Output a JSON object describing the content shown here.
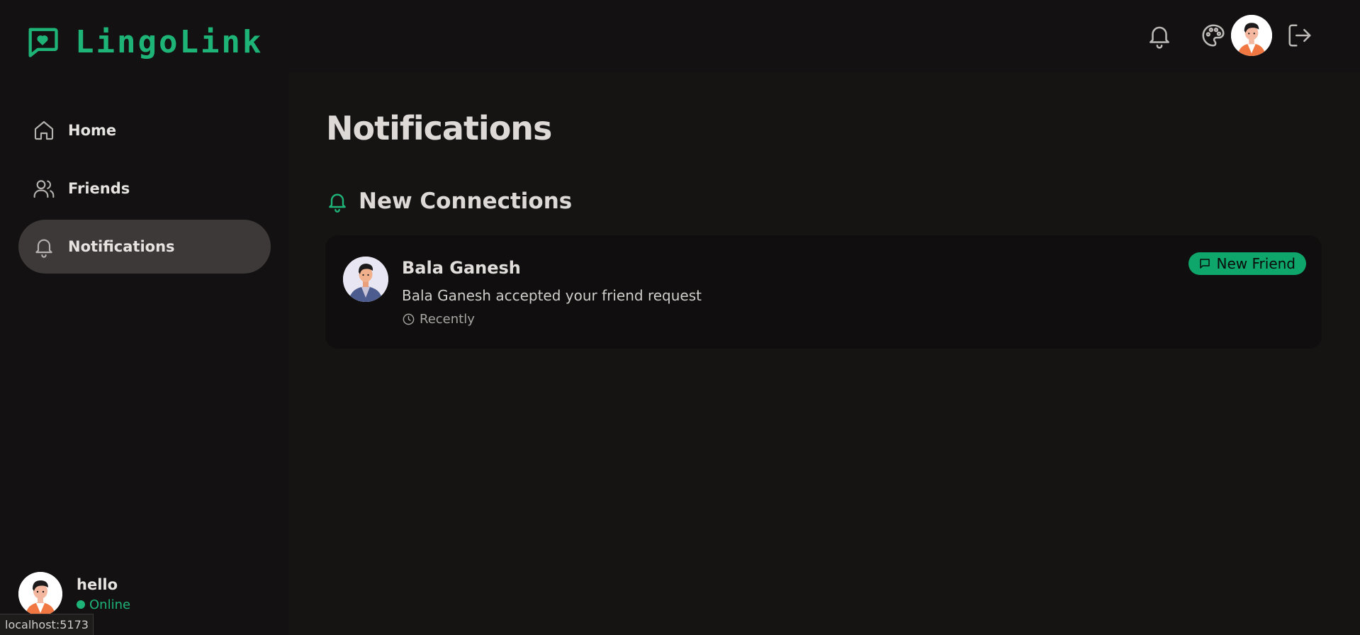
{
  "app": {
    "name": "LingoLink",
    "accent_color": "#1eb478",
    "logo_icon": "chat-heart-icon"
  },
  "sidebar": {
    "items": [
      {
        "label": "Home",
        "icon": "home-icon",
        "active": false
      },
      {
        "label": "Friends",
        "icon": "users-icon",
        "active": false
      },
      {
        "label": "Notifications",
        "icon": "bell-icon",
        "active": true
      }
    ],
    "user": {
      "name": "hello",
      "status": "Online"
    }
  },
  "header": {
    "icons": [
      "bell-icon",
      "palette-icon",
      "avatar",
      "logout-icon"
    ]
  },
  "main": {
    "title": "Notifications",
    "section": {
      "title": "New Connections",
      "icon": "bell-icon"
    },
    "notifications": [
      {
        "name": "Bala Ganesh",
        "message": "Bala Ganesh accepted your friend request",
        "time": "Recently",
        "badge": "New Friend"
      }
    ]
  },
  "status_bar": {
    "url": "localhost:5173"
  }
}
